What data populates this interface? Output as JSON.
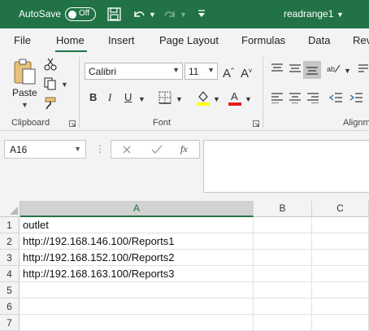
{
  "titlebar": {
    "autosave_label": "AutoSave",
    "autosave_state": "Off",
    "filename": "readrange1",
    "bg_color": "#217346"
  },
  "tabs": [
    "File",
    "Home",
    "Insert",
    "Page Layout",
    "Formulas",
    "Data",
    "Rev"
  ],
  "active_tab": "Home",
  "ribbon": {
    "clipboard": {
      "label": "Clipboard",
      "paste_label": "Paste"
    },
    "font": {
      "label": "Font",
      "font_name": "Calibri",
      "font_size": "11"
    },
    "alignment": {
      "label": "Alignm"
    }
  },
  "formula_bar": {
    "name_box": "A16",
    "fx_label": "fx",
    "formula_value": ""
  },
  "grid": {
    "columns": [
      "A",
      "B",
      "C"
    ],
    "selected_column": "A",
    "rows": [
      {
        "num": "1",
        "a": "outlet",
        "b": "",
        "c": ""
      },
      {
        "num": "2",
        "a": "http://192.168.146.100/Reports1",
        "b": "",
        "c": ""
      },
      {
        "num": "3",
        "a": "http://192.168.152.100/Reports2",
        "b": "",
        "c": ""
      },
      {
        "num": "4",
        "a": "http://192.168.163.100/Reports3",
        "b": "",
        "c": ""
      },
      {
        "num": "5",
        "a": "",
        "b": "",
        "c": ""
      },
      {
        "num": "6",
        "a": "",
        "b": "",
        "c": ""
      },
      {
        "num": "7",
        "a": "",
        "b": "",
        "c": ""
      }
    ]
  }
}
